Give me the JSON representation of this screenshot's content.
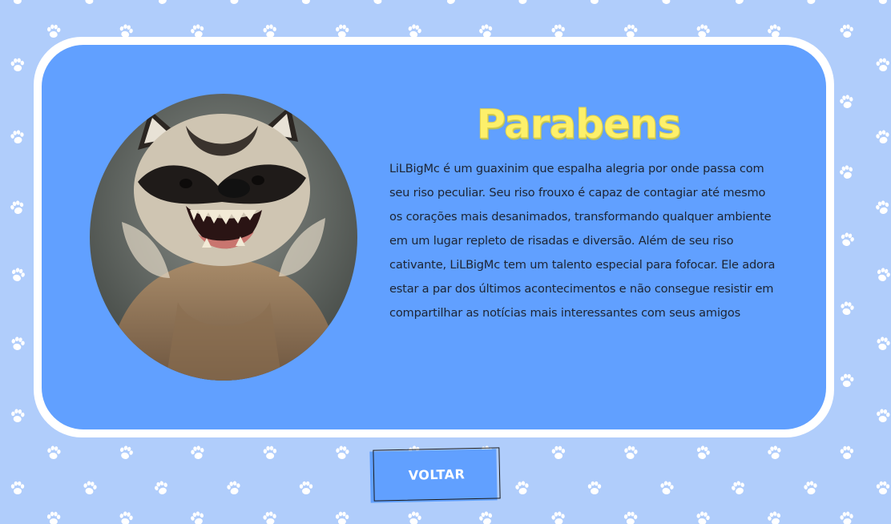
{
  "page": {
    "background_color": "#b0cdfb",
    "pattern_icon": "paw-print-icon"
  },
  "card": {
    "border_color": "#ffffff",
    "background_color": "#61a0ff",
    "image_icon": "raccoon-laughing-photo",
    "title": "Parabens",
    "title_color": "#fdf06a",
    "description": "LiLBigMc é um guaxinim que espalha alegria por onde passa com seu riso peculiar. Seu riso frouxo é capaz de contagiar até mesmo os corações mais desanimados, transformando qualquer ambiente em um lugar repleto de risadas e diversão. Além de seu riso cativante, LiLBigMc tem um talento especial para fofocar. Ele adora estar a par dos últimos acontecimentos e não consegue resistir em compartilhar as notícias mais interessantes com seus amigos"
  },
  "back_button": {
    "label": "VOLTAR",
    "background_color": "#61a0ff"
  }
}
